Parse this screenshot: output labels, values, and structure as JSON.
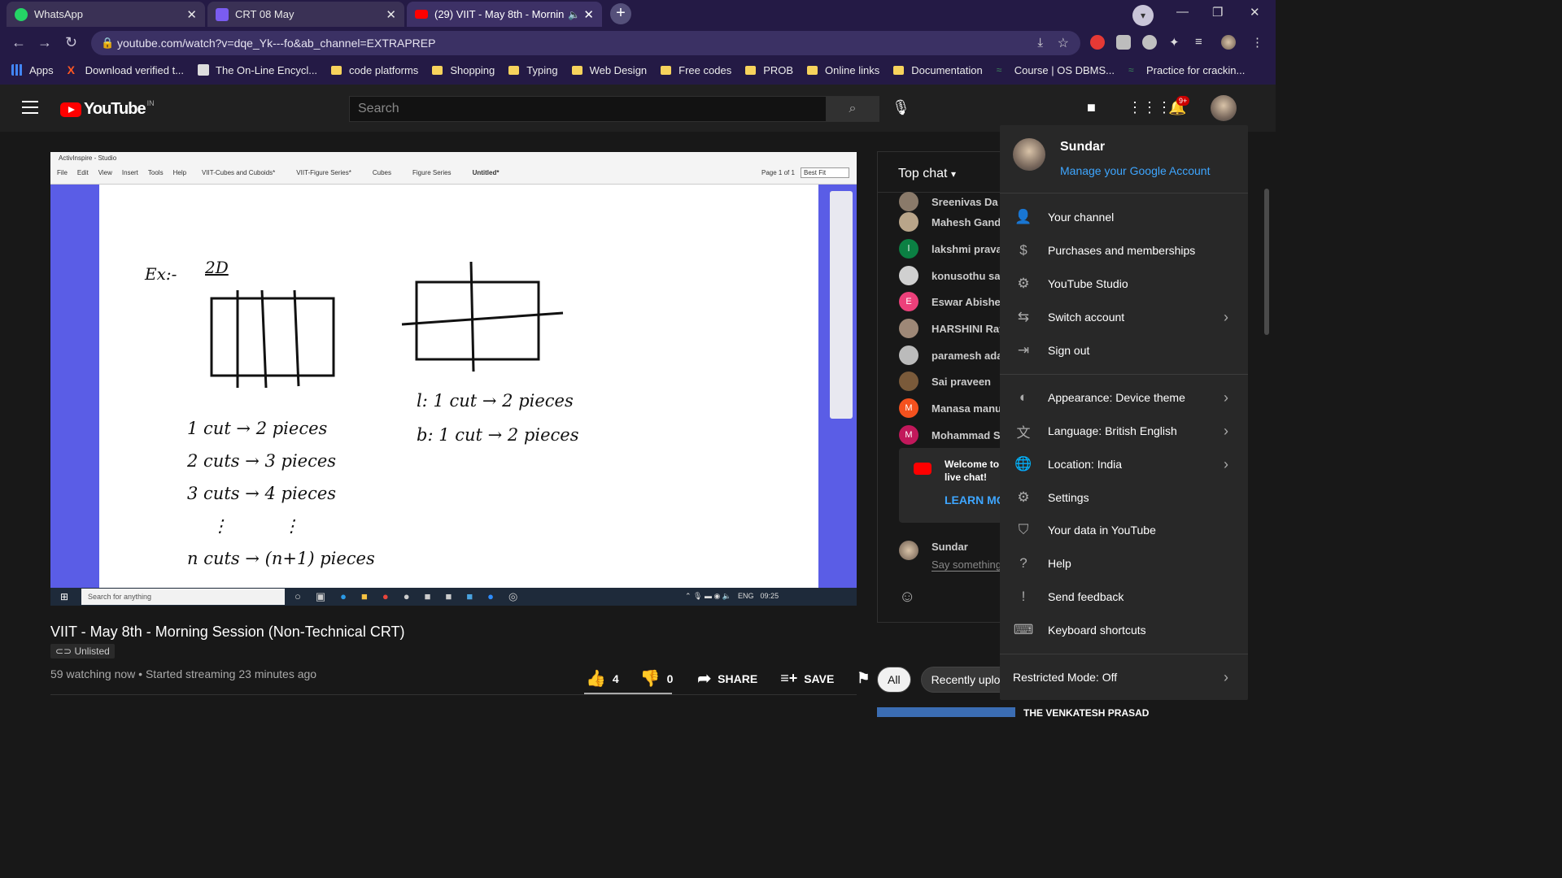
{
  "browser": {
    "tabs": [
      {
        "title": "WhatsApp",
        "color": "#25d366"
      },
      {
        "title": "CRT 08 May",
        "color": "#7a5cf0"
      },
      {
        "title": "(29) VIIT - May 8th - Mornin",
        "color": "#ff0000"
      }
    ],
    "url": "youtube.com/watch?v=dqe_Yk---fo&ab_channel=EXTRAPREP",
    "bookmarks": [
      "Apps",
      "Download verified t...",
      "The On-Line Encycl...",
      "code platforms",
      "Shopping",
      "Typing",
      "Web Design",
      "Free codes",
      "PROB",
      "Online links",
      "Documentation",
      "Course | OS DBMS...",
      "Practice for crackin..."
    ]
  },
  "youtube": {
    "logo_text": "YouTube",
    "country": "IN",
    "search_placeholder": "Search",
    "notif_count": "9+"
  },
  "video": {
    "app_title": "ActivInspire - Studio",
    "app_menu": [
      "File",
      "Edit",
      "View",
      "Insert",
      "Tools",
      "Help"
    ],
    "app_tabs": [
      "VIIT-Cubes and Cuboids*",
      "VIIT-Figure Series*",
      "Cubes",
      "Figure Series",
      "Untitled*"
    ],
    "page_label": "Page 1 of 1",
    "zoom": "Best Fit",
    "taskbar_search": "Search for anything",
    "taskbar_lang": "ENG",
    "taskbar_time": "09:25",
    "title": "VIIT - May 8th - Morning Session (Non-Technical CRT)",
    "badge": "Unlisted",
    "meta": "59 watching now • Started streaming 23 minutes ago",
    "likes": "4",
    "dislikes": "0",
    "share": "SHARE",
    "save": "SAVE"
  },
  "whiteboard": {
    "ex": "Ex:-",
    "dim": "2D",
    "left_lines": [
      "1 cut → 2 pieces",
      "2 cuts → 3 pieces",
      "3 cuts → 4 pieces",
      "n cuts → (n+1) pieces"
    ],
    "right_lines": [
      "l: 1 cut → 2 pieces",
      "b: 1 cut → 2 pieces"
    ]
  },
  "chat": {
    "header": "Top chat",
    "messages": [
      {
        "name": "Sreenivas Da",
        "color": "#8a7a6a",
        "initial": ""
      },
      {
        "name": "Mahesh Gandi",
        "color": "#b9a58a",
        "initial": ""
      },
      {
        "name": "lakshmi prava",
        "color": "#0b8043",
        "initial": "l"
      },
      {
        "name": "konusothu sai",
        "color": "#d0d0d0",
        "initial": ""
      },
      {
        "name": "Eswar Abishek",
        "color": "#ec407a",
        "initial": "E"
      },
      {
        "name": "HARSHINI Ray",
        "color": "#9e8877",
        "initial": ""
      },
      {
        "name": "paramesh ada",
        "color": "#bbbbbb",
        "initial": ""
      },
      {
        "name": "Sai praveen",
        "color": "#7a5a3a",
        "initial": ""
      },
      {
        "name": "Manasa manu",
        "color": "#f4511e",
        "initial": "M"
      },
      {
        "name": "Mohammad S",
        "color": "#c2185b",
        "initial": "M"
      }
    ],
    "welcome_text": "Welcome to live chat! Remember to guard your privacy and abide by our community guidelines.",
    "learn_more": "LEARN MORE",
    "user": "Sundar",
    "input_placeholder": "Say something..."
  },
  "chips": [
    "All",
    "Recently uploaded"
  ],
  "recommended_title": "THE VENKATESH PRASAD",
  "account_menu": {
    "name": "Sundar",
    "manage": "Manage your Google Account",
    "items": [
      {
        "label": "Your channel",
        "icon": "person-icon",
        "glyph": "👤",
        "chevron": false
      },
      {
        "label": "Purchases and memberships",
        "icon": "dollar-icon",
        "glyph": "$",
        "chevron": false
      },
      {
        "label": "YouTube Studio",
        "icon": "gear-icon",
        "glyph": "⚙",
        "chevron": false
      },
      {
        "label": "Switch account",
        "icon": "switch-account-icon",
        "glyph": "⇆",
        "chevron": true
      },
      {
        "label": "Sign out",
        "icon": "sign-out-icon",
        "glyph": "⇥",
        "chevron": false
      },
      {
        "label": "Appearance: Device theme",
        "icon": "appearance-icon",
        "glyph": "◐",
        "chevron": true
      },
      {
        "label": "Language: British English",
        "icon": "translate-icon",
        "glyph": "文",
        "chevron": true
      },
      {
        "label": "Location: India",
        "icon": "globe-icon",
        "glyph": "🌐",
        "chevron": true
      },
      {
        "label": "Settings",
        "icon": "settings-icon",
        "glyph": "⚙",
        "chevron": false
      },
      {
        "label": "Your data in YouTube",
        "icon": "shield-icon",
        "glyph": "⛉",
        "chevron": false
      },
      {
        "label": "Help",
        "icon": "help-icon",
        "glyph": "?",
        "chevron": false
      },
      {
        "label": "Send feedback",
        "icon": "feedback-icon",
        "glyph": "!",
        "chevron": false
      },
      {
        "label": "Keyboard shortcuts",
        "icon": "keyboard-icon",
        "glyph": "⌨",
        "chevron": false
      }
    ],
    "restricted": "Restricted Mode: Off"
  }
}
